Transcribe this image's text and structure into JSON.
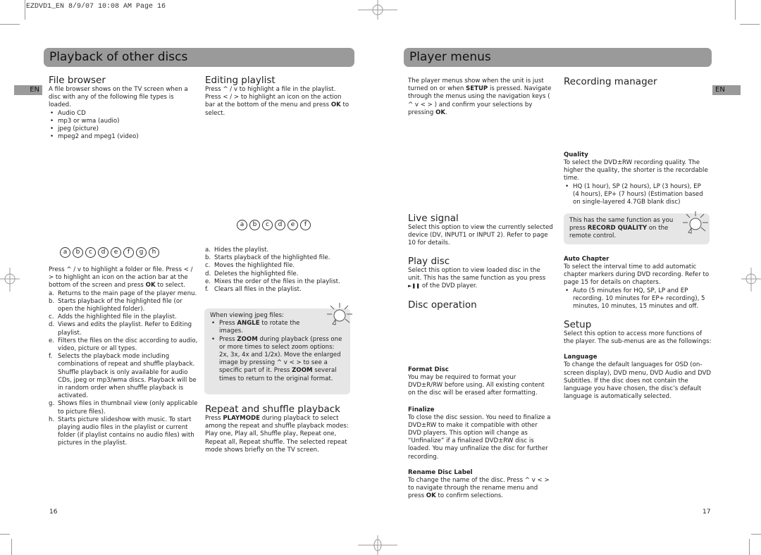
{
  "slug": "EZDVD1_EN  8/9/07  10:08 AM  Page 16",
  "left_page": {
    "title": "Playback of other discs",
    "lang_tab": "EN",
    "page_number": "16",
    "file_browser": {
      "heading": "File browser",
      "intro": "A file browser shows on the TV screen when a disc with any of the following file types is loaded.",
      "file_types": [
        "Audio CD",
        "mp3 or wma (audio)",
        "jpeg (picture)",
        "mpeg2 and mpeg1 (video)"
      ],
      "icon_letters": [
        "a",
        "b",
        "c",
        "d",
        "e",
        "f",
        "g",
        "h"
      ],
      "nav_text": {
        "pre": "Press ^ / v to highlight a folder or file. Press < / > to highlight an icon on the action bar at the bottom of the screen and press ",
        "key": "OK",
        "post": " to select."
      },
      "items": [
        {
          "k": "a.",
          "t": "Returns to the main page of the player menu."
        },
        {
          "k": "b.",
          "t": "Starts playback of the highlighted file (or open the highlighted folder)."
        },
        {
          "k": "c.",
          "t": "Adds the highlighted file in the playlist."
        },
        {
          "k": "d.",
          "t": "Views and edits the playlist. Refer to Editing playlist."
        },
        {
          "k": "e.",
          "t": "Filters the files on the disc according to audio, video, picture or all types."
        },
        {
          "k": "f.",
          "t": "Selects the playback mode including combinations of repeat and shuffle playback. Shuffle playback is only available for audio CDs, jpeg or mp3/wma discs. Playback will be in random order when shuffle playback is activated."
        },
        {
          "k": "g.",
          "t": "Shows files in thumbnail view (only applicable to picture files)."
        },
        {
          "k": "h.",
          "t": "Starts picture slideshow with music. To start playing audio files in the playlist or current folder (if playlist contains no audio files) with pictures in the playlist."
        }
      ]
    },
    "editing_playlist": {
      "heading": "Editing playlist",
      "text_pre": "Press ^ / v to highlight a file in the playlist. Press < / > to highlight an icon on the action bar at the bottom of the menu and press ",
      "text_key": "OK",
      "text_post": " to select.",
      "icon_letters": [
        "a",
        "b",
        "c",
        "d",
        "e",
        "f"
      ],
      "items": [
        {
          "k": "a.",
          "t": "Hides the playlist."
        },
        {
          "k": "b.",
          "t": "Starts playback of the highlighted file."
        },
        {
          "k": "c.",
          "t": "Moves the highlighted file."
        },
        {
          "k": "d.",
          "t": "Deletes the highlighted file."
        },
        {
          "k": "e.",
          "t": "Mixes the order of the files in the playlist."
        },
        {
          "k": "f.",
          "t": "Clears all files in the playlist."
        }
      ]
    },
    "jpeg_tip": {
      "intro": "When viewing jpeg files:",
      "b1_pre": "Press ",
      "b1_key": "ANGLE",
      "b1_post": " to rotate the images.",
      "b2_pre": "Press ",
      "b2_key": "ZOOM",
      "b2_mid": " during playback (press one or more times to select zoom options: 2x, 3x, 4x and 1/2x). Move the enlarged image by pressing ^ v < > to see a specific part of it. Press ",
      "b2_key2": "ZOOM",
      "b2_post": " several times to return to the original format."
    },
    "repeat_shuffle": {
      "heading": "Repeat and shuffle playback",
      "pre": "Press ",
      "key": "PLAYMODE",
      "post": " during playback to select among the repeat and shuffle playback modes: Play one, Play all, Shuffle play, Repeat one, Repeat all, Repeat shuffle. The selected repeat mode shows briefly on the TV screen."
    }
  },
  "right_page": {
    "title": "Player menus",
    "lang_tab": "EN",
    "page_number": "17",
    "intro": {
      "p1": "The player menus show when the unit is just turned on or when ",
      "k1": "SETUP",
      "p2": " is pressed. Navigate through the menus using the navigation keys ( ^ v < > ) and confirm your selections by pressing ",
      "k2": "OK",
      "p3": "."
    },
    "live_signal": {
      "heading": "Live signal",
      "text": "Select this option to view the currently selected device (DV, INPUT1 or INPUT 2). Refer to page 10 for details."
    },
    "play_disc": {
      "heading": "Play disc",
      "text": "Select this option to view loaded disc in the unit. This has the same function as you press",
      "icon": "►❚❚",
      "text2": " of the DVD player."
    },
    "disc_operation": {
      "heading": "Disc operation",
      "format": {
        "title": "Format Disc",
        "text": "You may be required to format your DVD±R/RW before using. All existing content on the disc will be erased after formatting."
      },
      "finalize": {
        "title": "Finalize",
        "text": "To close the disc session. You need to finalize a DVD±RW to make it compatible with other DVD players. This option will change as “Unfinalize” if a finalized DVD±RW disc is loaded. You may unfinalize the disc for further recording."
      },
      "rename": {
        "title": "Rename Disc Label",
        "pre": "To change the name of the disc. Press ^ v < > to navigate through the rename menu and press ",
        "key": "OK",
        "post": " to confirm selections."
      }
    },
    "recording_manager": {
      "heading": "Recording manager",
      "quality": {
        "title": "Quality",
        "text": "To select the DVD±RW recording quality. The higher the quality, the shorter is the recordable time.",
        "bullet": "HQ (1 hour), SP (2 hours), LP (3 hours), EP (4 hours), EP+ (7 hours) (Estimation based on single-layered 4.7GB blank disc)"
      },
      "tip": {
        "pre": "This has the same function as you press ",
        "key": "RECORD QUALITY",
        "post": " on the remote control."
      },
      "auto_chapter": {
        "title": "Auto Chapter",
        "text": "To select the interval time to add automatic chapter markers during DVD recording. Refer to page 15 for details on chapters.",
        "bullet": "Auto (5 minutes for HQ, SP, LP and EP recording. 10 minutes for EP+ recording), 5 minutes, 10 minutes, 15 minutes and off."
      }
    },
    "setup": {
      "heading": "Setup",
      "text": "Select this option to access more functions of the player. The sub-menus are as the followings:",
      "language": {
        "title": "Language",
        "text": "To change the default languages for OSD (on-screen display), DVD menu, DVD Audio and DVD Subtitles. If the disc does not contain the language you have chosen, the disc’s default language is automatically selected."
      }
    }
  }
}
